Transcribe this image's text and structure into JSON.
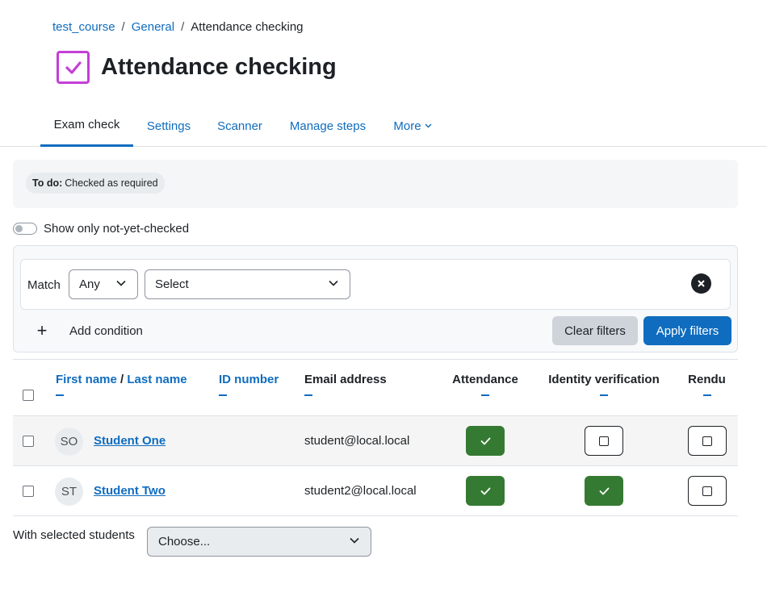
{
  "breadcrumb": {
    "course": "test_course",
    "section": "General",
    "current": "Attendance checking",
    "separator": "/"
  },
  "page": {
    "title": "Attendance checking",
    "icon": "checkbox-icon",
    "accent": "#c43fd6"
  },
  "tabs": [
    {
      "label": "Exam check",
      "active": true
    },
    {
      "label": "Settings"
    },
    {
      "label": "Scanner"
    },
    {
      "label": "Manage steps"
    },
    {
      "label": "More"
    }
  ],
  "todo": {
    "label": "To do:",
    "value": "Checked as required"
  },
  "toggle": {
    "label": "Show only not-yet-checked",
    "on": false
  },
  "filter": {
    "match_label": "Match",
    "match_value": "Any",
    "condition_value": "Select",
    "add_condition": "Add condition",
    "clear": "Clear filters",
    "apply": "Apply filters"
  },
  "table": {
    "headers": {
      "first_name": "First name",
      "name_sep": "/",
      "last_name": "Last name",
      "id_number": "ID number",
      "email": "Email address",
      "attendance": "Attendance",
      "identity": "Identity verification",
      "rendu": "Rendu"
    },
    "rows": [
      {
        "initials": "SO",
        "name": "Student One",
        "email": "student@local.local",
        "attendance": true,
        "identity": false,
        "rendu": false
      },
      {
        "initials": "ST",
        "name": "Student Two",
        "email": "student2@local.local",
        "attendance": true,
        "identity": true,
        "rendu": false
      }
    ]
  },
  "bulk": {
    "label": "With selected students",
    "value": "Choose..."
  },
  "colors": {
    "link": "#0f6cbf",
    "done": "#357a32",
    "primary_button": "#0f6cbf"
  }
}
